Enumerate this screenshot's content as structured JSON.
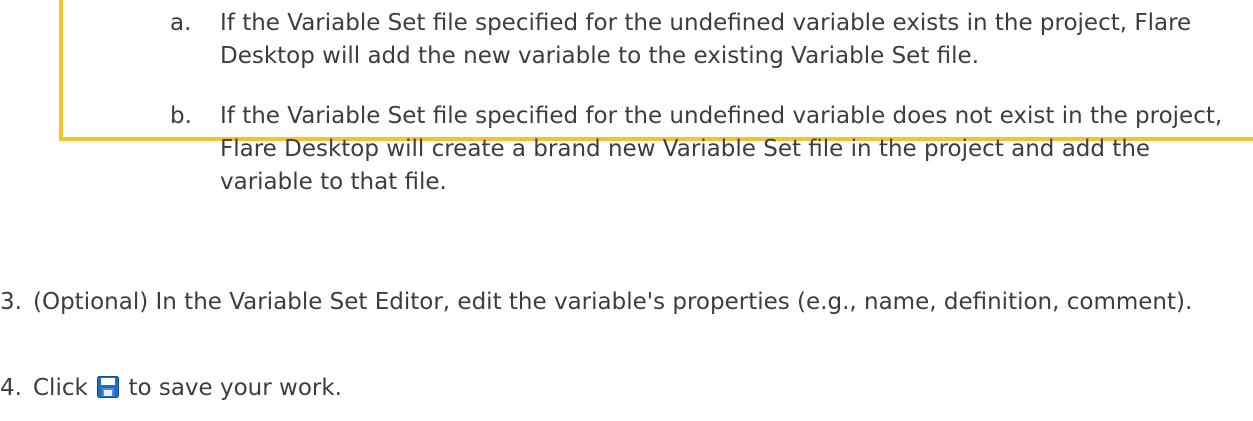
{
  "substeps": [
    {
      "marker": "a.",
      "text": "If the Variable Set file specified for the undefined variable exists in the project, Flare Desktop will add the new variable to the existing Variable Set file."
    },
    {
      "marker": "b.",
      "text": "If the Variable Set file specified for the undefined variable does not exist in the project, Flare Desktop will create a brand new Variable Set file in the project and add the variable to that file."
    }
  ],
  "steps": [
    {
      "marker": "3.",
      "text": "(Optional) In the Variable Set Editor, edit the variable's properties (e.g., name, definition, comment)."
    },
    {
      "marker": "4.",
      "before_icon": "Click",
      "icon": "save-icon",
      "after_icon": "to save your work."
    }
  ],
  "colors": {
    "callout_border": "#f7c22a",
    "text": "#3d3d3d",
    "icon_blue": "#1e6fc2"
  }
}
